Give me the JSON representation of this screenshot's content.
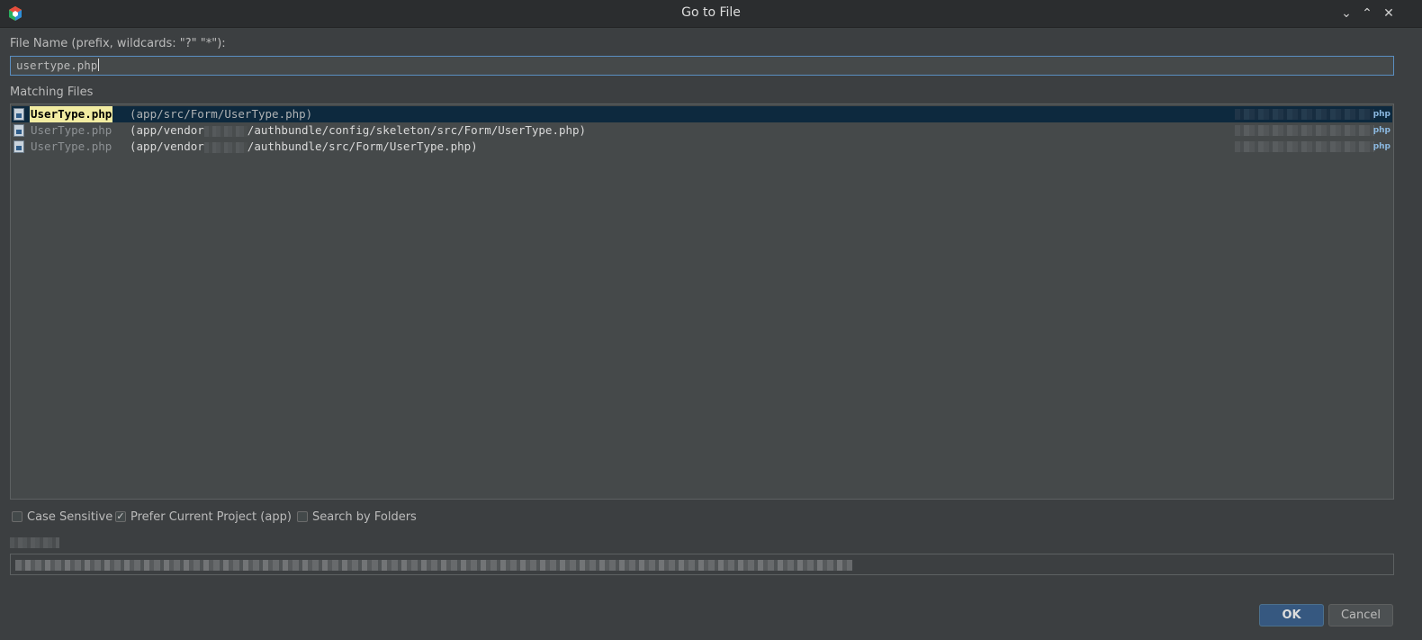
{
  "window": {
    "title": "Go to File",
    "minimize_glyph": "⌄",
    "maximize_glyph": "⌃",
    "close_glyph": "✕"
  },
  "search": {
    "label": "File Name (prefix, wildcards: \"?\" \"*\"):",
    "value": "usertype.php"
  },
  "results": {
    "label": "Matching Files",
    "rows": [
      {
        "name": "UserType.php",
        "path_start": "(app/src/Form/UserType.php)",
        "path_end": "",
        "badge": "php",
        "selected": true
      },
      {
        "name": "UserType.php",
        "path_start": "(app/vendor",
        "path_end": "/authbundle/config/skeleton/src/Form/UserType.php)",
        "badge": "php",
        "selected": false
      },
      {
        "name": "UserType.php",
        "path_start": "(app/vendor",
        "path_end": "/authbundle/src/Form/UserType.php)",
        "badge": "php",
        "selected": false
      }
    ]
  },
  "options": {
    "case_sensitive": {
      "label": "Case Sensitive",
      "checked": false
    },
    "prefer_current_project": {
      "label": "Prefer Current Project (app)",
      "checked": true
    },
    "search_by_folders": {
      "label": "Search by Folders",
      "checked": false
    }
  },
  "buttons": {
    "ok": "OK",
    "cancel": "Cancel"
  },
  "colors": {
    "selection_bg": "#0d293e",
    "match_highlight": "#f2eca2",
    "ok_button": "#365880"
  }
}
